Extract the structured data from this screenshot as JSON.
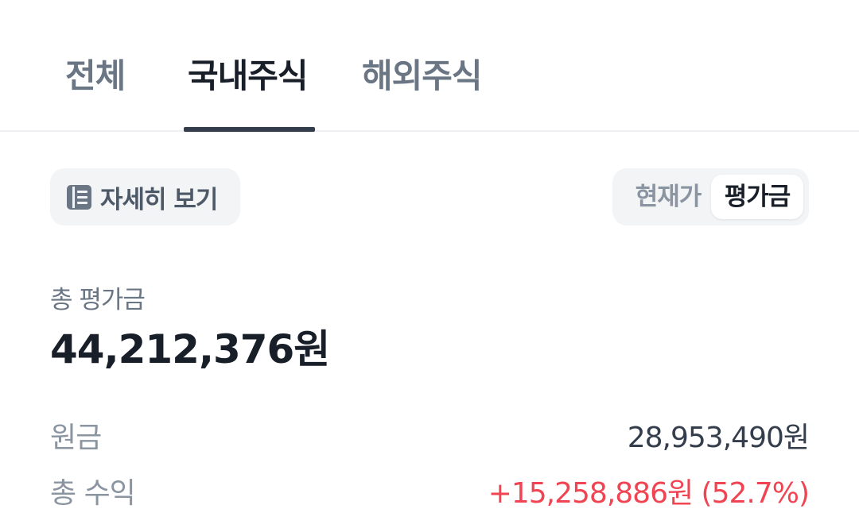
{
  "tabs": {
    "all": "전체",
    "domestic": "국내주식",
    "overseas": "해외주식"
  },
  "detail_button": {
    "label": "자세히 보기",
    "icon": "list-icon"
  },
  "segment": {
    "current_price": "현재가",
    "evaluation": "평가금",
    "selected": "평가금"
  },
  "summary": {
    "total_eval_label": "총 평가금",
    "total_eval_value": "44,212,376원",
    "principal_label": "원금",
    "principal_value": "28,953,490원",
    "total_profit_label": "총 수익",
    "total_profit_value": "+15,258,886원 (52.7%)"
  },
  "colors": {
    "profit": "#f04452",
    "active_tab_underline": "#333d4b",
    "chip_background": "#f2f4f6"
  }
}
